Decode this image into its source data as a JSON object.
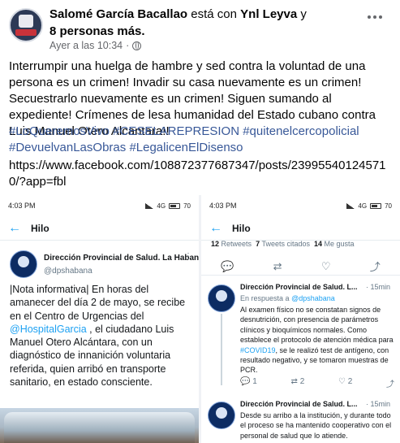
{
  "post": {
    "author": "Salomé García Bacallao",
    "with_text": "está con",
    "tagged": "Ynl Leyva",
    "and_text": "y",
    "others": "8 personas más.",
    "timestamp": "Ayer a las 10:34",
    "separator": "·",
    "body": "Interrumpir una huelga de hambre y sed contra la voluntad de una persona es un crimen! Invadir su casa nuevamente es un crimen! Secuestrarlo nuevamente es un crimen! Siguen sumando al expediente! Crímenes de lesa humanidad del Estado cubano contra Luis Manuel Otero Alcantara!!",
    "hashtags": [
      "#LoQueremosVivo",
      "#CESELAREPRESION",
      "#quitenelcercopolicial",
      "#DevuelvanLasObras",
      "#LegalicenElDisenso"
    ],
    "url": "https://www.facebook.com/108872377687347/posts/239955401245710/?app=fbl"
  },
  "left_screenshot": {
    "time": "4:03 PM",
    "status_extra": "4G",
    "battery": "70",
    "nav_title": "Hilo",
    "account_name": "Dirección Provincial de Salud. La Habana",
    "account_handle": "@dpshabana",
    "more": "⋮",
    "body_1": "|Nota informativa| En  horas del amanecer del día 2 de mayo, se recibe en el Centro de Urgencias del ",
    "body_mention": "@HospitalGarcia",
    "body_2": " , el ciudadano Luis Manuel Otero Alcántara, con un diagnóstico de innanición voluntaria referida, quien arribó en transporte sanitario, en estado consciente."
  },
  "right_screenshot": {
    "time": "4:03 PM",
    "status_extra": "4G",
    "battery": "70",
    "nav_title": "Hilo",
    "stats": {
      "retweets_n": "12",
      "retweets_label": "Retweets",
      "quotes_n": "7",
      "quotes_label": "Tweets citados",
      "likes_n": "14",
      "likes_label": "Me gusta"
    },
    "reply1": {
      "name": "Dirección Provincial de Salud. L...",
      "time": "· 15min",
      "in_reply_prefix": "En respuesta a",
      "in_reply_handle": "@dpshabana",
      "body_1": "Al examen físico no se constatan signos de desnutrición, con presencia de parámetros clínicos y bioquímicos normales. Como establece el protocolo de atención médica para ",
      "body_tag": "#COVID19",
      "body_2": ", se le realizó test de antígeno, con resultado negativo, y se tomaron muestras de PCR.",
      "replies": "1",
      "retweets": "2",
      "likes": "2"
    },
    "reply2": {
      "name": "Dirección Provincial de Salud. L...",
      "time": "· 15min",
      "body": "Desde su arribo a la institución, y durante todo el proceso se ha mantenido cooperativo con el personal de salud que lo atiende."
    }
  }
}
